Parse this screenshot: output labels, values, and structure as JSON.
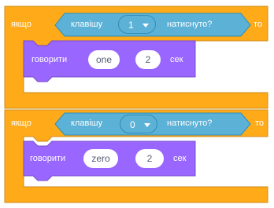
{
  "colors": {
    "control_orange": "#ffab19",
    "sensing_blue": "#5cb1d6",
    "looks_purple": "#9966ff",
    "text_white": "#ffffff",
    "input_text": "#575e75"
  },
  "blocks": [
    {
      "if_label": "якщо",
      "key_label": "клавішу",
      "key_value": "1",
      "pressed_label": "натиснуто?",
      "then_label": "то",
      "say_label": "говорити",
      "say_text": "one",
      "say_seconds": "2",
      "seconds_label": "сек"
    },
    {
      "if_label": "якщо",
      "key_label": "клавішу",
      "key_value": "0",
      "pressed_label": "натиснуто?",
      "then_label": "то",
      "say_label": "говорити",
      "say_text": "zero",
      "say_seconds": "2",
      "seconds_label": "сек"
    }
  ]
}
